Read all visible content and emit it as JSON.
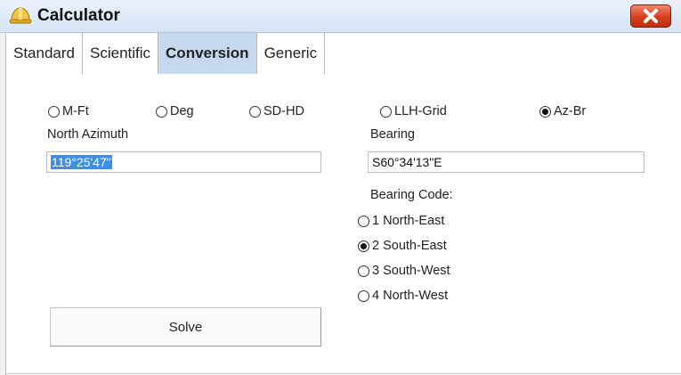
{
  "window": {
    "title": "Calculator"
  },
  "tabs": [
    {
      "label": "Standard",
      "active": false
    },
    {
      "label": "Scientific",
      "active": false
    },
    {
      "label": "Conversion",
      "active": true
    },
    {
      "label": "Generic",
      "active": false
    }
  ],
  "conversion_options": [
    {
      "label": "M-Ft",
      "checked": false
    },
    {
      "label": "Deg",
      "checked": false
    },
    {
      "label": "SD-HD",
      "checked": false
    },
    {
      "label": "LLH-Grid",
      "checked": false
    },
    {
      "label": "Az-Br",
      "checked": true
    }
  ],
  "left": {
    "label": "North Azimuth",
    "value": "119°25'47\""
  },
  "right": {
    "label": "Bearing",
    "value": "S60°34'13\"E"
  },
  "bearing_code": {
    "label": "Bearing Code:",
    "options": [
      {
        "label": "1 North-East",
        "checked": false
      },
      {
        "label": "2 South-East",
        "checked": true
      },
      {
        "label": "3 South-West",
        "checked": false
      },
      {
        "label": "4 North-West",
        "checked": false
      }
    ]
  },
  "solve_label": "Solve",
  "colors": {
    "active_tab": "#c5d8ee",
    "selection": "#3d8ee8",
    "close": "#d6401f"
  },
  "icons": {
    "app": "hard-hat-icon",
    "close": "close-icon"
  }
}
